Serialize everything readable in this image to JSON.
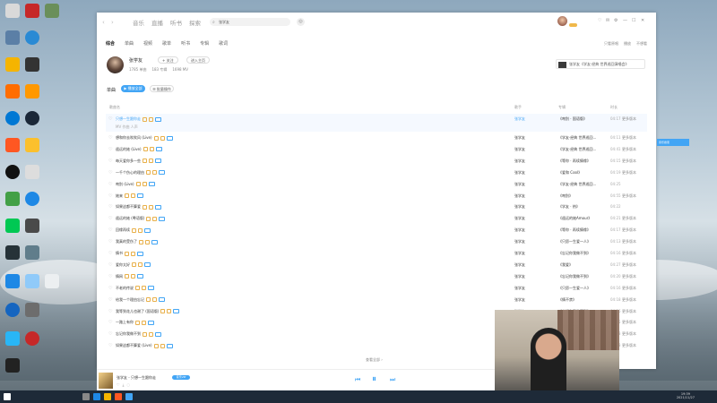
{
  "app": {
    "nav_tabs": [
      "音乐",
      "直播",
      "听书",
      "探索"
    ],
    "search_value": "张学友",
    "window_controls": [
      "♡",
      "✉",
      "⚙",
      "—",
      "☐",
      "✕"
    ]
  },
  "result_tabs": [
    "综合",
    "单曲",
    "视频",
    "歌单",
    "听书",
    "专辑",
    "歌词"
  ],
  "right_links": [
    "只看原唱",
    "播放",
    "不想看"
  ],
  "artist": {
    "name": "张学友",
    "follow_label": "关注",
    "enter_label": "进入主页",
    "stats": [
      "1785 单曲",
      "183 专辑",
      "1698 MV"
    ]
  },
  "related": {
    "text": "张学友《学友·经典 世界巡回演唱会》"
  },
  "songs_section": {
    "label": "单曲",
    "play_all": "播放全部",
    "batch": "批量操作"
  },
  "table_headers": {
    "title": "歌曲名",
    "artist": "歌手",
    "album": "专辑",
    "duration": "时长"
  },
  "songs": [
    {
      "title": "只想一生跟你走",
      "artist": "张学友",
      "album": "《吻别 · 国语版》",
      "duration": "04:17",
      "more": "更多版本",
      "sub": "MV 作曲 人声"
    },
    {
      "title": "想和你去吹吹风 (Live)",
      "artist": "张学友",
      "album": "《学友·经典 世界巡回...",
      "duration": "04:11",
      "more": "更多版本"
    },
    {
      "title": "遥远的她 (Live)",
      "artist": "张学友",
      "album": "《学友·经典 世界巡回...",
      "duration": "04:41",
      "more": "更多版本"
    },
    {
      "title": "每天爱你多一些",
      "artist": "张学友",
      "album": "《等你 · 再续情缘》",
      "duration": "04:15",
      "more": "更多版本"
    },
    {
      "title": "一千个伤心的理由",
      "artist": "张学友",
      "album": "《爱和 Cool》",
      "duration": "04:19",
      "more": "更多版本"
    },
    {
      "title": "吻别 (Live)",
      "artist": "张学友",
      "album": "《学友·经典 世界巡回...",
      "duration": "04:25",
      "more": ""
    },
    {
      "title": "她来",
      "artist": "张学友",
      "album": "《吻别》",
      "duration": "04:55",
      "more": "更多版本"
    },
    {
      "title": "如果这都不算爱",
      "artist": "张学友",
      "album": "《学友 · 热》",
      "duration": "04:22",
      "more": ""
    },
    {
      "title": "遥远的她 (粤语版)",
      "artist": "张学友",
      "album": "《遥远的她Amour》",
      "duration": "04:21",
      "more": "更多版本"
    },
    {
      "title": "回缘再续",
      "artist": "张学友",
      "album": "《等你 · 再续情缘》",
      "duration": "04:17",
      "more": "更多版本"
    },
    {
      "title": "我真的受伤了",
      "artist": "张学友",
      "album": "《只愿一生爱一人》",
      "duration": "04:13",
      "more": "更多版本"
    },
    {
      "title": "情书",
      "artist": "张学友",
      "album": "《忘记你我做不到》",
      "duration": "04:16",
      "more": "更多版本"
    },
    {
      "title": "爱你太好",
      "artist": "张学友",
      "album": "《我爱》",
      "duration": "04:27",
      "more": "更多版本"
    },
    {
      "title": "情网",
      "artist": "张学友",
      "album": "《忘记你我做不到》",
      "duration": "04:20",
      "more": "更多版本"
    },
    {
      "title": "不老的传说",
      "artist": "张学友",
      "album": "《只愿一生爱一人》",
      "duration": "04:16",
      "more": "更多版本"
    },
    {
      "title": "给我一个理由忘记",
      "artist": "张学友",
      "album": "《情不禁》",
      "duration": "04:18",
      "more": "更多版本"
    },
    {
      "title": "我等到花儿也谢了 (国语版)",
      "artist": "张学友",
      "album": "《忘记你我做不到》",
      "duration": "04:26",
      "more": "更多版本"
    },
    {
      "title": "一路上有你",
      "artist": "张学友",
      "album": "《一路上有你》",
      "duration": "04:05",
      "more": "更多版本"
    },
    {
      "title": "忘记你我做不到",
      "artist": "张学友",
      "album": "《忘记你我做不到》",
      "duration": "04:43",
      "more": "更多版本"
    },
    {
      "title": "如果这都不算爱 (Live)",
      "artist": "张学友",
      "album": "《学友·经典 世界巡回...",
      "duration": "05:43",
      "more": "更多版本"
    }
  ],
  "show_more": "查看全部",
  "player": {
    "now_playing": "张学友 - 只想一生跟你走",
    "vip": "音乐VIP"
  },
  "floating_badge": "音乐搜索",
  "clock": {
    "time": "19:39",
    "date": "2021/11/27"
  }
}
